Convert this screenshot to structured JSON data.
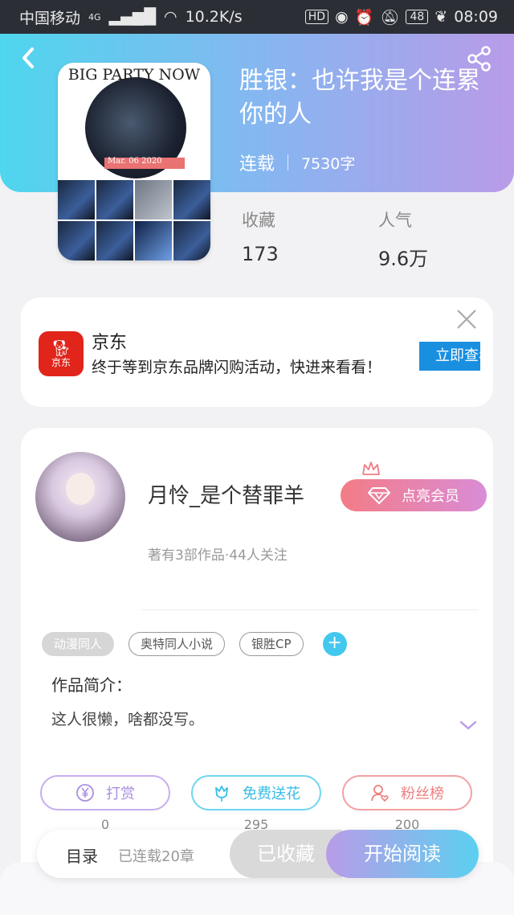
{
  "status_bar": {
    "carrier": "中国移动",
    "network": "4G",
    "speed": "10.2K/s",
    "hd": "HD",
    "battery": "48",
    "time": "08:09"
  },
  "book": {
    "cover_title": "BIG PARTY NOW",
    "cover_date": "Mar. 06 2020",
    "title": "胜银：也许我是个连累你的人",
    "status": "连载",
    "word_count": "7530字",
    "favorites_label": "收藏",
    "favorites_value": "173",
    "popularity_label": "人气",
    "popularity_value": "9.6万"
  },
  "ad": {
    "logo_text": "京东",
    "name": "京东",
    "description": "终于等到京东品牌闪购活动，快进来看看！",
    "button": "立即查看"
  },
  "author": {
    "name": "月怜_是个替罪羊",
    "stats": "著有3部作品·44人关注",
    "vip_button": "点亮会员",
    "tags": [
      "动漫同人",
      "奥特同人小说",
      "银胜CP"
    ],
    "add_tag": "+",
    "intro_label": "作品简介：",
    "intro_text": "这人很懒，啥都没写。"
  },
  "actions": {
    "reward_label": "打赏",
    "reward_count": "0",
    "flower_label": "免费送花",
    "flower_count": "295",
    "fans_label": "粉丝榜",
    "fans_count": "200"
  },
  "bottom_bar": {
    "toc": "目录",
    "chapters": "已连载20章",
    "collected": "已收藏",
    "start_reading": "开始阅读"
  },
  "colors": {
    "gradient_start": "#4fd6ee",
    "gradient_end": "#b99be8",
    "reward": "#b99be8",
    "flower": "#42c8ee",
    "fans": "#f08a8a",
    "ad_button": "#1a8fe0"
  }
}
